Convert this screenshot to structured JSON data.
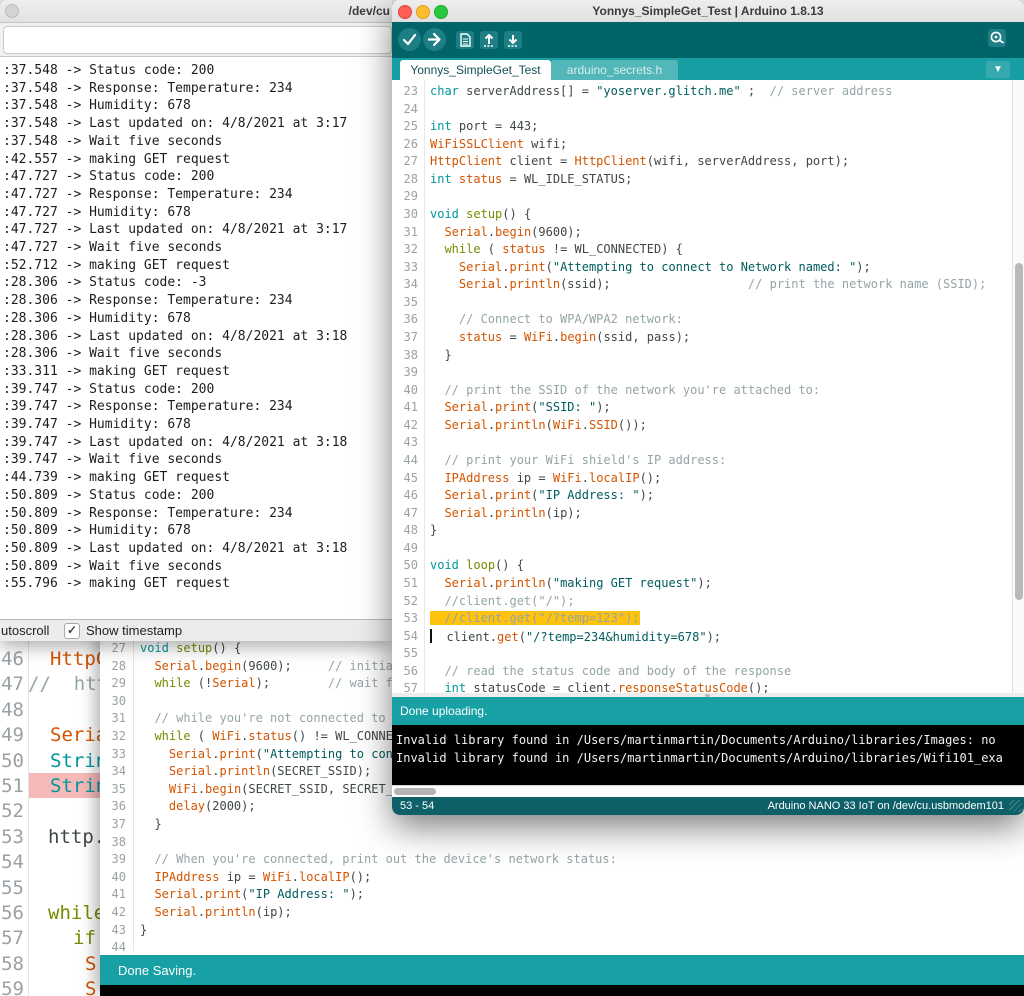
{
  "colors": {
    "teal_dark": "#006468",
    "teal_mid": "#17a1a5",
    "teal_tabs": "#179fa4",
    "teal_status": "#0d5f68",
    "highlight": "#ffc20e",
    "error_pink": "#f5b9b9",
    "console_bg": "#000000",
    "kw_type": "#00979c",
    "kw_flow": "#728e00",
    "kw_class": "#d35400",
    "string": "#005c5f",
    "comment": "#95a5a6"
  },
  "serial_monitor": {
    "title": "/dev/cu",
    "send_value": "",
    "autoscroll_label": "utoscroll",
    "show_timestamp_label": "Show timestamp",
    "timestamp_checked": "✓",
    "log_lines": [
      ":37.548 -> Status code: 200",
      ":37.548 -> Response: Temperature: 234",
      ":37.548 -> Humidity: 678",
      ":37.548 -> Last updated on: 4/8/2021 at 3:17",
      ":37.548 -> Wait five seconds",
      ":42.557 -> making GET request",
      ":47.727 -> Status code: 200",
      ":47.727 -> Response: Temperature: 234",
      ":47.727 -> Humidity: 678",
      ":47.727 -> Last updated on: 4/8/2021 at 3:17",
      ":47.727 -> Wait five seconds",
      ":52.712 -> making GET request",
      ":28.306 -> Status code: -3",
      ":28.306 -> Response: Temperature: 234",
      ":28.306 -> Humidity: 678",
      ":28.306 -> Last updated on: 4/8/2021 at 3:18",
      ":28.306 -> Wait five seconds",
      ":33.311 -> making GET request",
      ":39.747 -> Status code: 200",
      ":39.747 -> Response: Temperature: 234",
      ":39.747 -> Humidity: 678",
      ":39.747 -> Last updated on: 4/8/2021 at 3:18",
      ":39.747 -> Wait five seconds",
      ":44.739 -> making GET request",
      ":50.809 -> Status code: 200",
      ":50.809 -> Response: Temperature: 234",
      ":50.809 -> Humidity: 678",
      ":50.809 -> Last updated on: 4/8/2021 at 3:18",
      ":50.809 -> Wait five seconds",
      ":55.796 -> making GET request"
    ]
  },
  "left_editor": {
    "lines": [
      {
        "n": "46",
        "x": 50,
        "s": [
          [
            "cls",
            "HttpCl"
          ]
        ]
      },
      {
        "n": "47",
        "x": 28,
        "s": [
          [
            "com",
            "//  htt"
          ]
        ]
      },
      {
        "n": "48",
        "x": 28,
        "s": []
      },
      {
        "n": "49",
        "x": 50,
        "s": [
          [
            "cls",
            "Seria"
          ]
        ]
      },
      {
        "n": "50",
        "x": 50,
        "s": [
          [
            "kw1",
            "Strin"
          ]
        ]
      },
      {
        "n": "51",
        "x": 50,
        "pink": true,
        "s": [
          [
            "kw1",
            "Strin"
          ]
        ]
      },
      {
        "n": "52",
        "x": 28,
        "s": []
      },
      {
        "n": "53",
        "x": 48,
        "s": [
          [
            "pln",
            "http."
          ]
        ]
      },
      {
        "n": "54",
        "x": 28,
        "s": []
      },
      {
        "n": "55",
        "x": 28,
        "s": []
      },
      {
        "n": "56",
        "x": 48,
        "s": [
          [
            "kw3",
            "while"
          ]
        ]
      },
      {
        "n": "57",
        "x": 73,
        "s": [
          [
            "kw3",
            "if"
          ]
        ]
      },
      {
        "n": "58",
        "x": 85,
        "s": [
          [
            "cls",
            "S"
          ]
        ]
      },
      {
        "n": "59",
        "x": 85,
        "s": [
          [
            "cls",
            "S"
          ]
        ]
      }
    ]
  },
  "mid_editor": {
    "status_text": "Done Saving.",
    "lines": [
      {
        "n": "27",
        "s": [
          [
            "kw1",
            "void"
          ],
          [
            "pln",
            " "
          ],
          [
            "kw3",
            "setup"
          ],
          [
            "pln",
            "() {"
          ]
        ]
      },
      {
        "n": "28",
        "s": [
          [
            "pln",
            "  "
          ],
          [
            "cls",
            "Serial"
          ],
          [
            "pln",
            "."
          ],
          [
            "cls",
            "begin"
          ],
          [
            "pln",
            "(9600);     "
          ],
          [
            "com",
            "// initial"
          ]
        ]
      },
      {
        "n": "29",
        "s": [
          [
            "pln",
            "  "
          ],
          [
            "kw3",
            "while"
          ],
          [
            "pln",
            " (!"
          ],
          [
            "cls",
            "Serial"
          ],
          [
            "pln",
            ");        "
          ],
          [
            "com",
            "// wait fo"
          ]
        ]
      },
      {
        "n": "30",
        "s": []
      },
      {
        "n": "31",
        "s": [
          [
            "pln",
            "  "
          ],
          [
            "com",
            "// while you're not connected to a"
          ]
        ]
      },
      {
        "n": "32",
        "s": [
          [
            "pln",
            "  "
          ],
          [
            "kw3",
            "while"
          ],
          [
            "pln",
            " ( "
          ],
          [
            "cls",
            "WiFi"
          ],
          [
            "pln",
            "."
          ],
          [
            "cls",
            "status"
          ],
          [
            "pln",
            "() != WL_CONNEC"
          ]
        ]
      },
      {
        "n": "33",
        "s": [
          [
            "pln",
            "    "
          ],
          [
            "cls",
            "Serial"
          ],
          [
            "pln",
            "."
          ],
          [
            "cls",
            "print"
          ],
          [
            "pln",
            "("
          ],
          [
            "str",
            "\"Attempting to conn"
          ]
        ]
      },
      {
        "n": "34",
        "s": [
          [
            "pln",
            "    "
          ],
          [
            "cls",
            "Serial"
          ],
          [
            "pln",
            "."
          ],
          [
            "cls",
            "println"
          ],
          [
            "pln",
            "(SECRET_SSID);"
          ]
        ]
      },
      {
        "n": "35",
        "s": [
          [
            "pln",
            "    "
          ],
          [
            "cls",
            "WiFi"
          ],
          [
            "pln",
            "."
          ],
          [
            "cls",
            "begin"
          ],
          [
            "pln",
            "(SECRET_SSID, SECRET_P"
          ]
        ]
      },
      {
        "n": "36",
        "s": [
          [
            "pln",
            "    "
          ],
          [
            "cls",
            "delay"
          ],
          [
            "pln",
            "(2000);"
          ]
        ]
      },
      {
        "n": "37",
        "s": [
          [
            "pln",
            "  }"
          ]
        ]
      },
      {
        "n": "38",
        "s": []
      },
      {
        "n": "39",
        "s": [
          [
            "pln",
            "  "
          ],
          [
            "com",
            "// When you're connected, print out the device's network status:"
          ]
        ]
      },
      {
        "n": "40",
        "s": [
          [
            "pln",
            "  "
          ],
          [
            "cls",
            "IPAddress"
          ],
          [
            "pln",
            " ip = "
          ],
          [
            "cls",
            "WiFi"
          ],
          [
            "pln",
            "."
          ],
          [
            "cls",
            "localIP"
          ],
          [
            "pln",
            "();"
          ]
        ]
      },
      {
        "n": "41",
        "s": [
          [
            "pln",
            "  "
          ],
          [
            "cls",
            "Serial"
          ],
          [
            "pln",
            "."
          ],
          [
            "cls",
            "print"
          ],
          [
            "pln",
            "("
          ],
          [
            "str",
            "\"IP Address: \""
          ],
          [
            "pln",
            ");"
          ]
        ]
      },
      {
        "n": "42",
        "s": [
          [
            "pln",
            "  "
          ],
          [
            "cls",
            "Serial"
          ],
          [
            "pln",
            "."
          ],
          [
            "cls",
            "println"
          ],
          [
            "pln",
            "(ip);"
          ]
        ]
      },
      {
        "n": "43",
        "s": [
          [
            "pln",
            "}"
          ]
        ]
      },
      {
        "n": "44",
        "s": []
      }
    ]
  },
  "fg_window": {
    "title": "Yonnys_SimpleGet_Test | Arduino 1.8.13",
    "tab_active": "Yonnys_SimpleGet_Test",
    "tab_inactive": "arduino_secrets.h",
    "dropdown_glyph": "▼",
    "upload_status": "Done uploading.",
    "statusbar_left": "53 - 54",
    "statusbar_right": "Arduino NANO 33 IoT on /dev/cu.usbmodem101",
    "console_lines": [
      "Invalid library found in /Users/martinmartin/Documents/Arduino/libraries/Images: no",
      "Invalid library found in /Users/martinmartin/Documents/Arduino/libraries/Wifi101_exa"
    ],
    "editor_lines": [
      {
        "n": "23",
        "s": [
          [
            "kw1",
            "char"
          ],
          [
            "pln",
            " serverAddress[] = "
          ],
          [
            "str",
            "\"yoserver.glitch.me\""
          ],
          [
            "pln",
            " ;  "
          ],
          [
            "com",
            "// server address"
          ]
        ]
      },
      {
        "n": "24",
        "s": []
      },
      {
        "n": "25",
        "s": [
          [
            "kw1",
            "int"
          ],
          [
            "pln",
            " port = 443;"
          ]
        ]
      },
      {
        "n": "26",
        "s": [
          [
            "cls",
            "WiFiSSLClient"
          ],
          [
            "pln",
            " wifi;"
          ]
        ]
      },
      {
        "n": "27",
        "s": [
          [
            "cls",
            "HttpClient"
          ],
          [
            "pln",
            " client = "
          ],
          [
            "cls",
            "HttpClient"
          ],
          [
            "pln",
            "(wifi, serverAddress, port);"
          ]
        ]
      },
      {
        "n": "28",
        "s": [
          [
            "kw1",
            "int"
          ],
          [
            "pln",
            " "
          ],
          [
            "cls",
            "status"
          ],
          [
            "pln",
            " = WL_IDLE_STATUS;"
          ]
        ]
      },
      {
        "n": "29",
        "s": []
      },
      {
        "n": "30",
        "s": [
          [
            "kw1",
            "void"
          ],
          [
            "pln",
            " "
          ],
          [
            "kw3",
            "setup"
          ],
          [
            "pln",
            "() {"
          ]
        ]
      },
      {
        "n": "31",
        "s": [
          [
            "pln",
            "  "
          ],
          [
            "cls",
            "Serial"
          ],
          [
            "pln",
            "."
          ],
          [
            "cls",
            "begin"
          ],
          [
            "pln",
            "(9600);"
          ]
        ]
      },
      {
        "n": "32",
        "s": [
          [
            "pln",
            "  "
          ],
          [
            "kw3",
            "while"
          ],
          [
            "pln",
            " ( "
          ],
          [
            "cls",
            "status"
          ],
          [
            "pln",
            " != WL_CONNECTED) {"
          ]
        ]
      },
      {
        "n": "33",
        "s": [
          [
            "pln",
            "    "
          ],
          [
            "cls",
            "Serial"
          ],
          [
            "pln",
            "."
          ],
          [
            "cls",
            "print"
          ],
          [
            "pln",
            "("
          ],
          [
            "str",
            "\"Attempting to connect to Network named: \""
          ],
          [
            "pln",
            ");"
          ]
        ]
      },
      {
        "n": "34",
        "s": [
          [
            "pln",
            "    "
          ],
          [
            "cls",
            "Serial"
          ],
          [
            "pln",
            "."
          ],
          [
            "cls",
            "println"
          ],
          [
            "pln",
            "(ssid);                   "
          ],
          [
            "com",
            "// print the network name (SSID);"
          ]
        ]
      },
      {
        "n": "35",
        "s": []
      },
      {
        "n": "36",
        "s": [
          [
            "pln",
            "    "
          ],
          [
            "com",
            "// Connect to WPA/WPA2 network:"
          ]
        ]
      },
      {
        "n": "37",
        "s": [
          [
            "pln",
            "    "
          ],
          [
            "cls",
            "status"
          ],
          [
            "pln",
            " = "
          ],
          [
            "cls",
            "WiFi"
          ],
          [
            "pln",
            "."
          ],
          [
            "cls",
            "begin"
          ],
          [
            "pln",
            "(ssid, pass);"
          ]
        ]
      },
      {
        "n": "38",
        "s": [
          [
            "pln",
            "  }"
          ]
        ]
      },
      {
        "n": "39",
        "s": []
      },
      {
        "n": "40",
        "s": [
          [
            "pln",
            "  "
          ],
          [
            "com",
            "// print the SSID of the network you're attached to:"
          ]
        ]
      },
      {
        "n": "41",
        "s": [
          [
            "pln",
            "  "
          ],
          [
            "cls",
            "Serial"
          ],
          [
            "pln",
            "."
          ],
          [
            "cls",
            "print"
          ],
          [
            "pln",
            "("
          ],
          [
            "str",
            "\"SSID: \""
          ],
          [
            "pln",
            ");"
          ]
        ]
      },
      {
        "n": "42",
        "s": [
          [
            "pln",
            "  "
          ],
          [
            "cls",
            "Serial"
          ],
          [
            "pln",
            "."
          ],
          [
            "cls",
            "println"
          ],
          [
            "pln",
            "("
          ],
          [
            "cls",
            "WiFi"
          ],
          [
            "pln",
            "."
          ],
          [
            "cls",
            "SSID"
          ],
          [
            "pln",
            "());"
          ]
        ]
      },
      {
        "n": "43",
        "s": []
      },
      {
        "n": "44",
        "s": [
          [
            "pln",
            "  "
          ],
          [
            "com",
            "// print your WiFi shield's IP address:"
          ]
        ]
      },
      {
        "n": "45",
        "s": [
          [
            "pln",
            "  "
          ],
          [
            "cls",
            "IPAddress"
          ],
          [
            "pln",
            " ip = "
          ],
          [
            "cls",
            "WiFi"
          ],
          [
            "pln",
            "."
          ],
          [
            "cls",
            "localIP"
          ],
          [
            "pln",
            "();"
          ]
        ]
      },
      {
        "n": "46",
        "s": [
          [
            "pln",
            "  "
          ],
          [
            "cls",
            "Serial"
          ],
          [
            "pln",
            "."
          ],
          [
            "cls",
            "print"
          ],
          [
            "pln",
            "("
          ],
          [
            "str",
            "\"IP Address: \""
          ],
          [
            "pln",
            ");"
          ]
        ]
      },
      {
        "n": "47",
        "s": [
          [
            "pln",
            "  "
          ],
          [
            "cls",
            "Serial"
          ],
          [
            "pln",
            "."
          ],
          [
            "cls",
            "println"
          ],
          [
            "pln",
            "(ip);"
          ]
        ]
      },
      {
        "n": "48",
        "s": [
          [
            "pln",
            "}"
          ]
        ]
      },
      {
        "n": "49",
        "s": []
      },
      {
        "n": "50",
        "s": [
          [
            "kw1",
            "void"
          ],
          [
            "pln",
            " "
          ],
          [
            "kw3",
            "loop"
          ],
          [
            "pln",
            "() {"
          ]
        ]
      },
      {
        "n": "51",
        "s": [
          [
            "pln",
            "  "
          ],
          [
            "cls",
            "Serial"
          ],
          [
            "pln",
            "."
          ],
          [
            "cls",
            "println"
          ],
          [
            "pln",
            "("
          ],
          [
            "str",
            "\"making GET request\""
          ],
          [
            "pln",
            ");"
          ]
        ]
      },
      {
        "n": "52",
        "s": [
          [
            "pln",
            "  "
          ],
          [
            "com",
            "//client.get(\"/\");"
          ]
        ]
      },
      {
        "n": "53",
        "hl": true,
        "s": [
          [
            "com",
            "//client.get(\"/?temp=123\");"
          ]
        ]
      },
      {
        "n": "54",
        "cur": true,
        "s": [
          [
            "pln",
            "  client."
          ],
          [
            "cls",
            "get"
          ],
          [
            "pln",
            "("
          ],
          [
            "str",
            "\"/?temp=234&humidity=678\""
          ],
          [
            "pln",
            ");"
          ]
        ]
      },
      {
        "n": "55",
        "s": []
      },
      {
        "n": "56",
        "s": [
          [
            "pln",
            "  "
          ],
          [
            "com",
            "// read the status code and body of the response"
          ]
        ]
      },
      {
        "n": "57",
        "s": [
          [
            "pln",
            "  "
          ],
          [
            "kw1",
            "int"
          ],
          [
            "pln",
            " statusCode = client."
          ],
          [
            "cls",
            "responseStatusCode"
          ],
          [
            "pln",
            "();"
          ]
        ]
      }
    ]
  }
}
